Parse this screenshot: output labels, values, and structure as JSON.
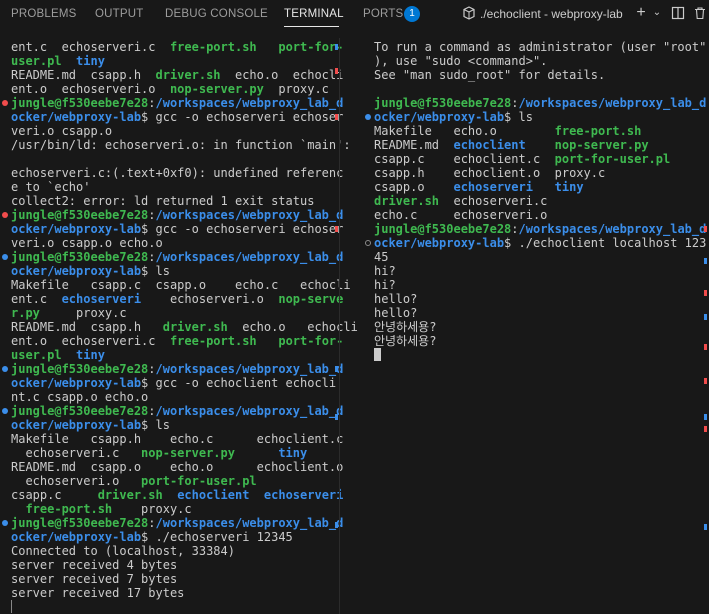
{
  "panel_tabs": [
    {
      "label": "PROBLEMS"
    },
    {
      "label": "OUTPUT"
    },
    {
      "label": "DEBUG CONSOLE"
    },
    {
      "label": "TERMINAL"
    },
    {
      "label": "PORTS"
    }
  ],
  "ports_badge": "1",
  "terminal_title": "./echoclient - webproxy-lab",
  "colors": {
    "prompt": "#3fb950",
    "path": "#3b8eea",
    "accent": "#0078d4"
  },
  "left_pane": [
    {
      "t": [
        [
          "ent.c  echoserveri.c  ",
          ""
        ],
        [
          "free-port.sh",
          "g"
        ],
        [
          "   ",
          ""
        ],
        [
          "port-for-",
          "g"
        ]
      ]
    },
    {
      "t": [
        [
          "user.pl",
          "g"
        ],
        [
          "  ",
          ""
        ],
        [
          "tiny",
          "b"
        ]
      ]
    },
    {
      "t": [
        [
          "README.md  csapp.h  ",
          ""
        ],
        [
          "driver.sh",
          "g"
        ],
        [
          "  echo.o  echocli",
          ""
        ]
      ]
    },
    {
      "t": [
        [
          "ent.o  echoserveri.o  ",
          ""
        ],
        [
          "nop-server.py",
          "g"
        ],
        [
          "  proxy.c",
          ""
        ]
      ]
    },
    {
      "t": [
        [
          "jungle@f530eebe7e28",
          "g"
        ],
        [
          ":",
          ""
        ],
        [
          "/workspaces/webproxy_lab_d",
          "b"
        ]
      ],
      "dot": "err"
    },
    {
      "t": [
        [
          "ocker/webproxy-lab",
          "b"
        ],
        [
          "$ gcc -o echoserveri echoser",
          ""
        ]
      ]
    },
    {
      "t": [
        [
          "veri.o csapp.o",
          ""
        ]
      ]
    },
    {
      "t": [
        [
          "/usr/bin/ld: echoserveri.o: in function `main':",
          ""
        ]
      ]
    },
    {
      "t": [
        [
          "",
          ""
        ]
      ]
    },
    {
      "t": [
        [
          "echoserveri.c:(.text+0xf0): undefined referenc",
          ""
        ]
      ]
    },
    {
      "t": [
        [
          "e to `echo'",
          ""
        ]
      ]
    },
    {
      "t": [
        [
          "collect2: error: ld returned 1 exit status",
          ""
        ]
      ]
    },
    {
      "t": [
        [
          "jungle@f530eebe7e28",
          "g"
        ],
        [
          ":",
          ""
        ],
        [
          "/workspaces/webproxy_lab_d",
          "b"
        ]
      ],
      "dot": "err"
    },
    {
      "t": [
        [
          "ocker/webproxy-lab",
          "b"
        ],
        [
          "$ gcc -o echoserveri echoser",
          ""
        ]
      ]
    },
    {
      "t": [
        [
          "veri.o csapp.o echo.o",
          ""
        ]
      ]
    },
    {
      "t": [
        [
          "jungle@f530eebe7e28",
          "g"
        ],
        [
          ":",
          ""
        ],
        [
          "/workspaces/webproxy_lab_d",
          "b"
        ]
      ],
      "dot": "ok"
    },
    {
      "t": [
        [
          "ocker/webproxy-lab",
          "b"
        ],
        [
          "$ ls",
          ""
        ]
      ]
    },
    {
      "t": [
        [
          "Makefile   csapp.c  csapp.o    echo.c   echocli",
          ""
        ]
      ]
    },
    {
      "t": [
        [
          "ent.c  ",
          ""
        ],
        [
          "echoserveri",
          "b"
        ],
        [
          "    echoserveri.o  ",
          ""
        ],
        [
          "nop-serve",
          "g"
        ]
      ]
    },
    {
      "t": [
        [
          "r.py",
          "g"
        ],
        [
          "     proxy.c",
          ""
        ]
      ]
    },
    {
      "t": [
        [
          "README.md  csapp.h   ",
          ""
        ],
        [
          "driver.sh",
          "g"
        ],
        [
          "  echo.o   echocli",
          ""
        ]
      ]
    },
    {
      "t": [
        [
          "ent.o  echoserveri.c  ",
          ""
        ],
        [
          "free-port.sh",
          "g"
        ],
        [
          "   ",
          ""
        ],
        [
          "port-for-",
          "g"
        ]
      ]
    },
    {
      "t": [
        [
          "user.pl",
          "g"
        ],
        [
          "  ",
          ""
        ],
        [
          "tiny",
          "b"
        ]
      ]
    },
    {
      "t": [
        [
          "jungle@f530eebe7e28",
          "g"
        ],
        [
          ":",
          ""
        ],
        [
          "/workspaces/webproxy_lab_d",
          "b"
        ]
      ],
      "dot": "ok"
    },
    {
      "t": [
        [
          "ocker/webproxy-lab",
          "b"
        ],
        [
          "$ gcc -o echoclient echocli",
          ""
        ]
      ]
    },
    {
      "t": [
        [
          "nt.c csapp.o echo.o",
          ""
        ]
      ]
    },
    {
      "t": [
        [
          "jungle@f530eebe7e28",
          "g"
        ],
        [
          ":",
          ""
        ],
        [
          "/workspaces/webproxy_lab_d",
          "b"
        ]
      ],
      "dot": "ok"
    },
    {
      "t": [
        [
          "ocker/webproxy-lab",
          "b"
        ],
        [
          "$ ls",
          ""
        ]
      ]
    },
    {
      "t": [
        [
          "Makefile   csapp.h    echo.c      echoclient.c",
          ""
        ]
      ]
    },
    {
      "t": [
        [
          "  echoserveri.c   ",
          ""
        ],
        [
          "nop-server.py",
          "g"
        ],
        [
          "      ",
          ""
        ],
        [
          "tiny",
          "b"
        ]
      ]
    },
    {
      "t": [
        [
          "README.md  csapp.o    echo.o      echoclient.o",
          ""
        ]
      ]
    },
    {
      "t": [
        [
          "  echoserveri.o   ",
          ""
        ],
        [
          "port-for-user.pl",
          "g"
        ]
      ]
    },
    {
      "t": [
        [
          "csapp.c     ",
          ""
        ],
        [
          "driver.sh",
          "g"
        ],
        [
          "  ",
          ""
        ],
        [
          "echoclient",
          "b"
        ],
        [
          "  ",
          ""
        ],
        [
          "echoserveri",
          "b"
        ]
      ]
    },
    {
      "t": [
        [
          "  ",
          ""
        ],
        [
          "free-port.sh",
          "g"
        ],
        [
          "    proxy.c",
          ""
        ]
      ]
    },
    {
      "t": [
        [
          "jungle@f530eebe7e28",
          "g"
        ],
        [
          ":",
          ""
        ],
        [
          "/workspaces/webproxy_lab_d",
          "b"
        ]
      ],
      "dot": "ok"
    },
    {
      "t": [
        [
          "ocker/webproxy-lab",
          "b"
        ],
        [
          "$ ./echoserveri 12345",
          ""
        ]
      ]
    },
    {
      "t": [
        [
          "Connected to (localhost, 33384)",
          ""
        ]
      ]
    },
    {
      "t": [
        [
          "server received 4 bytes",
          ""
        ]
      ]
    },
    {
      "t": [
        [
          "server received 7 bytes",
          ""
        ]
      ]
    },
    {
      "t": [
        [
          "server received 17 bytes",
          ""
        ]
      ]
    },
    {
      "t": [
        [
          "",
          ""
        ]
      ],
      "cursor": "outline"
    }
  ],
  "right_pane": [
    {
      "t": [
        [
          "To run a command as administrator (user \"root\"",
          ""
        ]
      ]
    },
    {
      "t": [
        [
          "), use \"sudo <command>\".",
          ""
        ]
      ]
    },
    {
      "t": [
        [
          "See \"man sudo_root\" for details.",
          ""
        ]
      ]
    },
    {
      "t": [
        [
          "",
          ""
        ]
      ]
    },
    {
      "t": [
        [
          "jungle@f530eebe7e28",
          "g"
        ],
        [
          ":",
          ""
        ],
        [
          "/workspaces/webproxy_lab_d",
          "b"
        ]
      ]
    },
    {
      "t": [
        [
          "ocker/webproxy-lab",
          "b"
        ],
        [
          "$ ls",
          ""
        ]
      ],
      "dot": "ok"
    },
    {
      "t": [
        [
          "Makefile   echo.o        ",
          ""
        ],
        [
          "free-port.sh",
          "g"
        ]
      ]
    },
    {
      "t": [
        [
          "README.md  ",
          ""
        ],
        [
          "echoclient",
          "b"
        ],
        [
          "    ",
          ""
        ],
        [
          "nop-server.py",
          "g"
        ]
      ]
    },
    {
      "t": [
        [
          "csapp.c    echoclient.c  ",
          ""
        ],
        [
          "port-for-user.pl",
          "g"
        ]
      ]
    },
    {
      "t": [
        [
          "csapp.h    echoclient.o  proxy.c",
          ""
        ]
      ]
    },
    {
      "t": [
        [
          "csapp.o    ",
          ""
        ],
        [
          "echoserveri",
          "b"
        ],
        [
          "   ",
          ""
        ],
        [
          "tiny",
          "b"
        ]
      ]
    },
    {
      "t": [
        [
          "driver.sh",
          "g"
        ],
        [
          "  echoserveri.c",
          ""
        ]
      ]
    },
    {
      "t": [
        [
          "echo.c     echoserveri.o",
          ""
        ]
      ]
    },
    {
      "t": [
        [
          "jungle@f530eebe7e28",
          "g"
        ],
        [
          ":",
          ""
        ],
        [
          "/workspaces/webproxy_lab_d",
          "b"
        ]
      ]
    },
    {
      "t": [
        [
          "ocker/webproxy-lab",
          "b"
        ],
        [
          "$ ./echoclient localhost 123",
          ""
        ]
      ],
      "dot": "idle"
    },
    {
      "t": [
        [
          "45",
          ""
        ]
      ]
    },
    {
      "t": [
        [
          "hi?",
          ""
        ]
      ]
    },
    {
      "t": [
        [
          "hi?",
          ""
        ]
      ]
    },
    {
      "t": [
        [
          "hello?",
          ""
        ]
      ]
    },
    {
      "t": [
        [
          "hello?",
          ""
        ]
      ]
    },
    {
      "t": [
        [
          "안녕하세용?",
          ""
        ]
      ]
    },
    {
      "t": [
        [
          "안녕하세용?",
          ""
        ]
      ]
    },
    {
      "t": [
        [
          "",
          ""
        ]
      ],
      "cursor": "block"
    }
  ]
}
